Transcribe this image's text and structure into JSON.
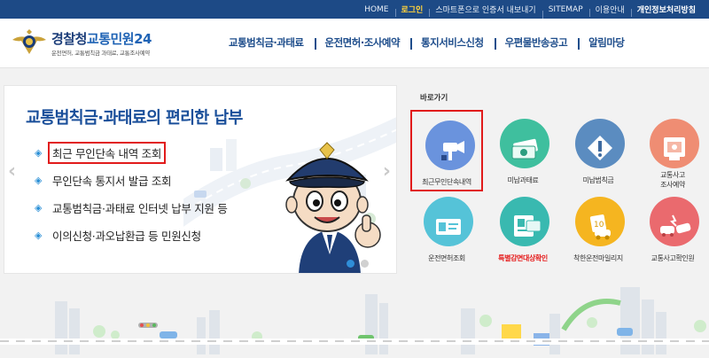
{
  "topbar": {
    "home": "HOME",
    "login": "로그인",
    "smartphone": "스마트폰으로 인증서 내보내기",
    "sitemap": "SITEMAP",
    "guide": "이용안내",
    "privacy": "개인정보처리방침"
  },
  "logo": {
    "org": "경찰청",
    "service": "교통민원24",
    "subtitle": "운전면허, 교통범칙금 과태료, 교통조사예약"
  },
  "gnb": [
    "교통범칙금·과태료",
    "운전면허·조사예약",
    "통지서비스신청",
    "우편물반송공고",
    "알림마당"
  ],
  "banner": {
    "title": "교통범칙금·과태료의 편리한 납부",
    "items": [
      "최근 무인단속 내역 조회",
      "무인단속 통지서 발급 조회",
      "교통범칙금·과태료 인터넷 납부 지원 등",
      "이의신청·과오납환급 등 민원신청"
    ],
    "bullet": "◈",
    "prev": "‹",
    "next": "›"
  },
  "quick": {
    "title": "바로가기",
    "items": [
      {
        "label": "최근무인단속내역",
        "icon": "speed-camera-icon",
        "color": "#6a93dd"
      },
      {
        "label": "미납과태료",
        "icon": "money-icon",
        "color": "#3fbf9e"
      },
      {
        "label": "미납범칙금",
        "icon": "warning-sign-icon",
        "color": "#5b8cc0"
      },
      {
        "label": "교통사고\n조사예약",
        "icon": "accident-report-icon",
        "color": "#ef8d73"
      },
      {
        "label": "운전면허조회",
        "icon": "license-card-icon",
        "color": "#55c3d8"
      },
      {
        "label": "특별감면대상확인",
        "icon": "id-card-icon",
        "color": "#39b9b0"
      },
      {
        "label": "착한운전마일리지",
        "icon": "mileage-icon",
        "color": "#f5b520"
      },
      {
        "label": "교통사고확인원",
        "icon": "car-crash-icon",
        "color": "#ea6a6e"
      }
    ]
  },
  "colors": {
    "brand": "#1d4a86",
    "highlight": "#e11b1b",
    "accent": "#2f8ed8"
  }
}
